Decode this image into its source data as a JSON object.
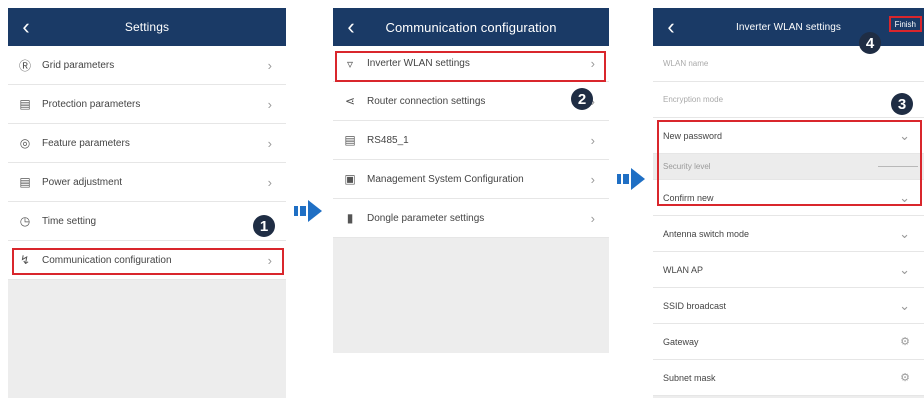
{
  "screen1": {
    "title": "Settings",
    "items": [
      {
        "label": "Grid parameters",
        "icon": "grid-icon"
      },
      {
        "label": "Protection parameters",
        "icon": "protection-icon"
      },
      {
        "label": "Feature parameters",
        "icon": "feature-icon"
      },
      {
        "label": "Power adjustment",
        "icon": "power-icon"
      },
      {
        "label": "Time setting",
        "icon": "clock-icon"
      },
      {
        "label": "Communication configuration",
        "icon": "communication-icon"
      }
    ]
  },
  "screen2": {
    "title": "Communication configuration",
    "items": [
      {
        "label": "Inverter WLAN settings",
        "icon": "wifi-icon"
      },
      {
        "label": "Router connection settings",
        "icon": "share-icon"
      },
      {
        "label": "RS485_1",
        "icon": "rs485-icon"
      },
      {
        "label": "Management System Configuration",
        "icon": "monitor-icon"
      },
      {
        "label": "Dongle parameter settings",
        "icon": "dongle-icon"
      }
    ]
  },
  "screen3": {
    "title": "Inverter WLAN settings",
    "finish_label": "Finish",
    "items": [
      {
        "label": "WLAN name"
      },
      {
        "label": "Encryption mode"
      },
      {
        "label": "New password"
      },
      {
        "label": "Security level"
      },
      {
        "label": "Confirm new"
      },
      {
        "label": "Antenna switch mode"
      },
      {
        "label": "WLAN AP"
      },
      {
        "label": "SSID broadcast"
      },
      {
        "label": "Gateway"
      },
      {
        "label": "Subnet mask"
      }
    ]
  },
  "badges": [
    "1",
    "2",
    "3",
    "4"
  ],
  "colors": {
    "topbar": "#1a3a66",
    "highlight": "#d9262c",
    "arrow": "#1f6fc4",
    "badge": "#1f2d44"
  }
}
